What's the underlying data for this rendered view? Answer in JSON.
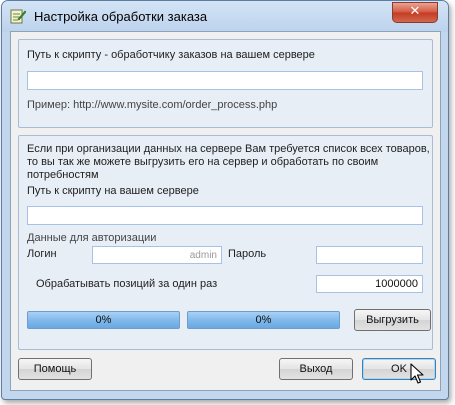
{
  "window": {
    "title": "Настройка обработки заказа",
    "close_label": "✕"
  },
  "script_section": {
    "path_label": "Путь к скрипту - обработчику заказов на вашем сервере",
    "path_value": "",
    "example_text": "Пример: http://www.mysite.com/order_process.php"
  },
  "products_section": {
    "description_line1": "Если при организации данных на сервере Вам требуется список всех товаров,",
    "description_line2": "то вы так же можете выгрузить его на сервер и обработать по своим",
    "description_line3": "потребностям",
    "path_label": "Путь к скрипту на вашем сервере",
    "path_value": "",
    "auth_label": "Данные для авторизации",
    "login_label": "Логин",
    "login_value": "admin",
    "password_label": "Пароль",
    "password_value": "",
    "batch_label": "Обрабатывать позиций за один раз",
    "batch_value": "1000000",
    "progress1_text": "0%",
    "progress1_value": 0,
    "progress2_text": "0%",
    "progress2_value": 0,
    "upload_button": "Выгрузить"
  },
  "footer": {
    "help_button": "Помощь",
    "exit_button": "Выход",
    "ok_button": "OK"
  },
  "icons": {
    "app": "document-pencil-icon",
    "cursor": "mouse-pointer-icon"
  }
}
